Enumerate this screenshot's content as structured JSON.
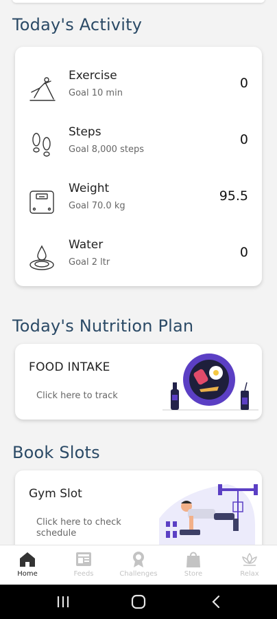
{
  "activity": {
    "title": "Today's Activity",
    "items": [
      {
        "name": "Exercise",
        "goal": "Goal 10 min",
        "value": "0",
        "icon": "exercise-icon"
      },
      {
        "name": "Steps",
        "goal": "Goal 8,000 steps",
        "value": "0",
        "icon": "footsteps-icon"
      },
      {
        "name": "Weight",
        "goal": "Goal 70.0 kg",
        "value": "95.5",
        "icon": "scale-icon"
      },
      {
        "name": "Water",
        "goal": "Goal 2 ltr",
        "value": "0",
        "icon": "water-drop-icon"
      }
    ]
  },
  "nutrition": {
    "title": "Today's Nutrition Plan",
    "card_title": "FOOD INTAKE",
    "card_sub": "Click here to track"
  },
  "slots": {
    "title": "Book Slots",
    "card_title": "Gym Slot",
    "card_sub": "Click here to check schedule"
  },
  "nav": {
    "items": [
      {
        "label": "Home",
        "icon": "home-icon",
        "active": true
      },
      {
        "label": "Feeds",
        "icon": "feeds-icon",
        "active": false
      },
      {
        "label": "Challenges",
        "icon": "medal-icon",
        "active": false
      },
      {
        "label": "Store",
        "icon": "shopping-bag-icon",
        "active": false
      },
      {
        "label": "Relax",
        "icon": "lotus-icon",
        "active": false
      }
    ]
  },
  "colors": {
    "title": "#2b4a66",
    "accent_purple": "#5b3fc4",
    "background": "#f3f3f3"
  }
}
